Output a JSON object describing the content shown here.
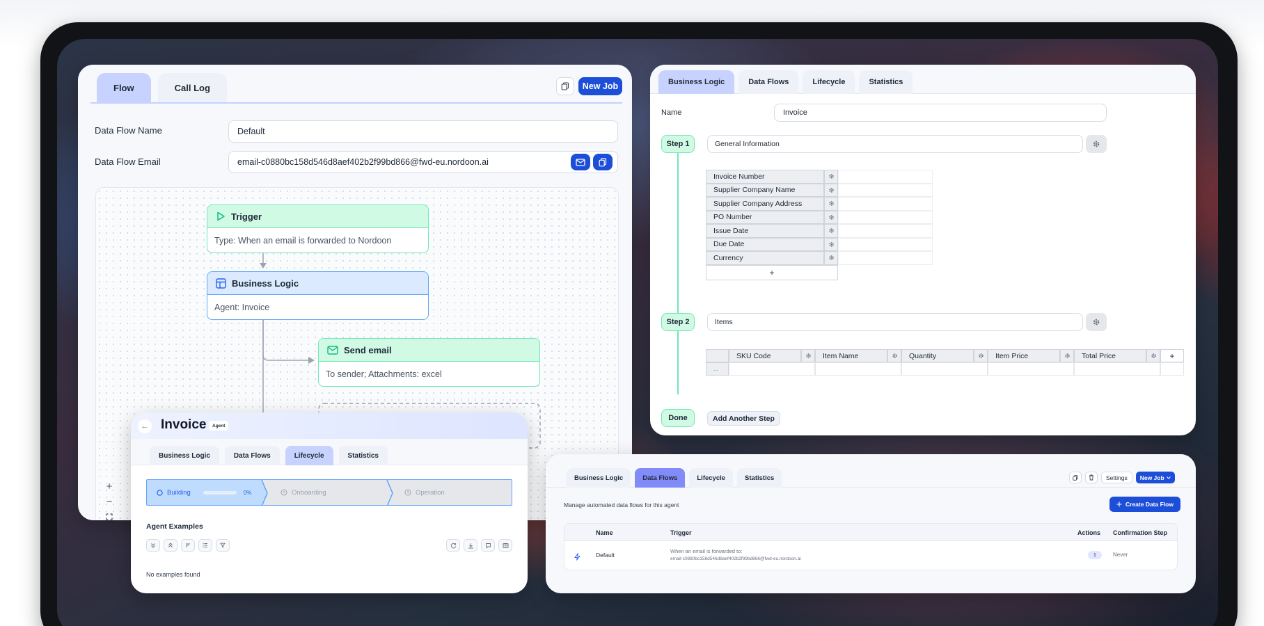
{
  "flow_panel": {
    "tabs": [
      {
        "label": "Flow",
        "active": true
      },
      {
        "label": "Call Log",
        "active": false
      }
    ],
    "new_job_label": "New Job",
    "name_label": "Data Flow Name",
    "name_value": "Default",
    "email_label": "Data Flow Email",
    "email_value": "email-c0880bc158d546d8aef402b2f99bd866@fwd-eu.nordoon.ai",
    "nodes": {
      "trigger": {
        "title": "Trigger",
        "body": "Type: When an email is forwarded to Nordoon"
      },
      "business_logic": {
        "title": "Business Logic",
        "body": "Agent: Invoice"
      },
      "send_email": {
        "title": "Send email",
        "body": "To sender; Attachments: excel"
      }
    },
    "zoom": {
      "in": "+",
      "out": "−"
    }
  },
  "business_logic_panel": {
    "tabs": [
      {
        "label": "Business Logic",
        "active": true
      },
      {
        "label": "Data Flows",
        "active": false
      },
      {
        "label": "Lifecycle",
        "active": false
      },
      {
        "label": "Statistics",
        "active": false
      }
    ],
    "name_label": "Name",
    "name_value": "Invoice",
    "step1": {
      "label": "Step 1",
      "name": "General Information",
      "fields": [
        "Invoice Number",
        "Supplier Company Name",
        "Supplier Company Address",
        "PO Number",
        "Issue Date",
        "Due Date",
        "Currency"
      ],
      "add_label": "+"
    },
    "step2": {
      "label": "Step 2",
      "name": "Items",
      "columns": [
        "SKU Code",
        "Item Name",
        "Quantity",
        "Item Price",
        "Total Price"
      ],
      "add_col_label": "+",
      "row_marker": "..."
    },
    "done_label": "Done",
    "add_step_label": "Add Another Step"
  },
  "invoice_panel": {
    "back_label": "←",
    "title": "Invoice",
    "badge": "Agent",
    "tabs": [
      {
        "label": "Business Logic",
        "active": false
      },
      {
        "label": "Data Flows",
        "active": false
      },
      {
        "label": "Lifecycle",
        "active": true
      },
      {
        "label": "Statistics",
        "active": false
      }
    ],
    "stages": [
      {
        "label": "Building",
        "progress_text": "0%",
        "progress": 0
      },
      {
        "label": "Onboarding"
      },
      {
        "label": "Operation"
      }
    ],
    "examples_title": "Agent Examples",
    "empty_text": "No examples found"
  },
  "data_flows_panel": {
    "tabs": [
      {
        "label": "Business Logic",
        "active": false
      },
      {
        "label": "Data Flows",
        "active": true
      },
      {
        "label": "Lifecycle",
        "active": false
      },
      {
        "label": "Statistics",
        "active": false
      }
    ],
    "settings_label": "Settings",
    "new_job_label": "New Job",
    "description": "Manage automated data flows for this agent",
    "create_label": "Create Data Flow",
    "columns": [
      "Name",
      "Trigger",
      "Actions",
      "Confirmation Step"
    ],
    "row": {
      "name": "Default",
      "trigger_line1": "When an email is forwarded to:",
      "trigger_line2": "email-c0880bc158d546d8aef402b2f99bd866@fwd-eu.nordoon.ai",
      "actions": "1",
      "confirmation": "Never"
    }
  },
  "colors": {
    "primary": "#1d4ed8",
    "active_tab": "#c7d2fe",
    "node_green": "#d1fae5",
    "node_blue": "#dbeafe"
  }
}
